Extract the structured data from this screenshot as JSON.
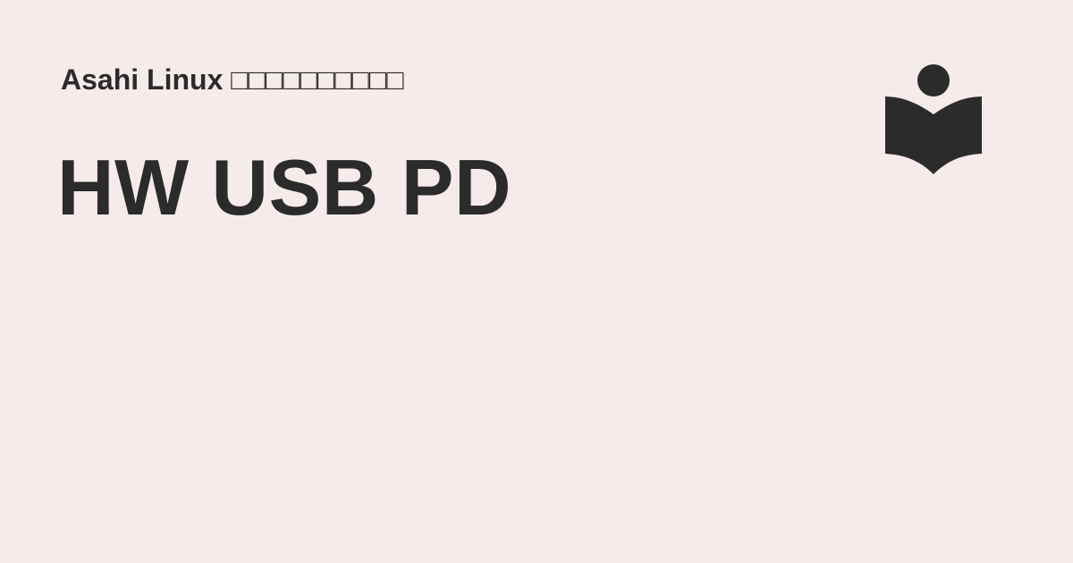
{
  "site": {
    "name": "Asahi Linux □□□□□□□□□□"
  },
  "page": {
    "title": "HW USB PD"
  },
  "logo": {
    "icon": "reader-book-icon"
  },
  "colors": {
    "background": "#f5ebea",
    "text": "#2b2b2b",
    "icon": "#2b2b2b"
  }
}
